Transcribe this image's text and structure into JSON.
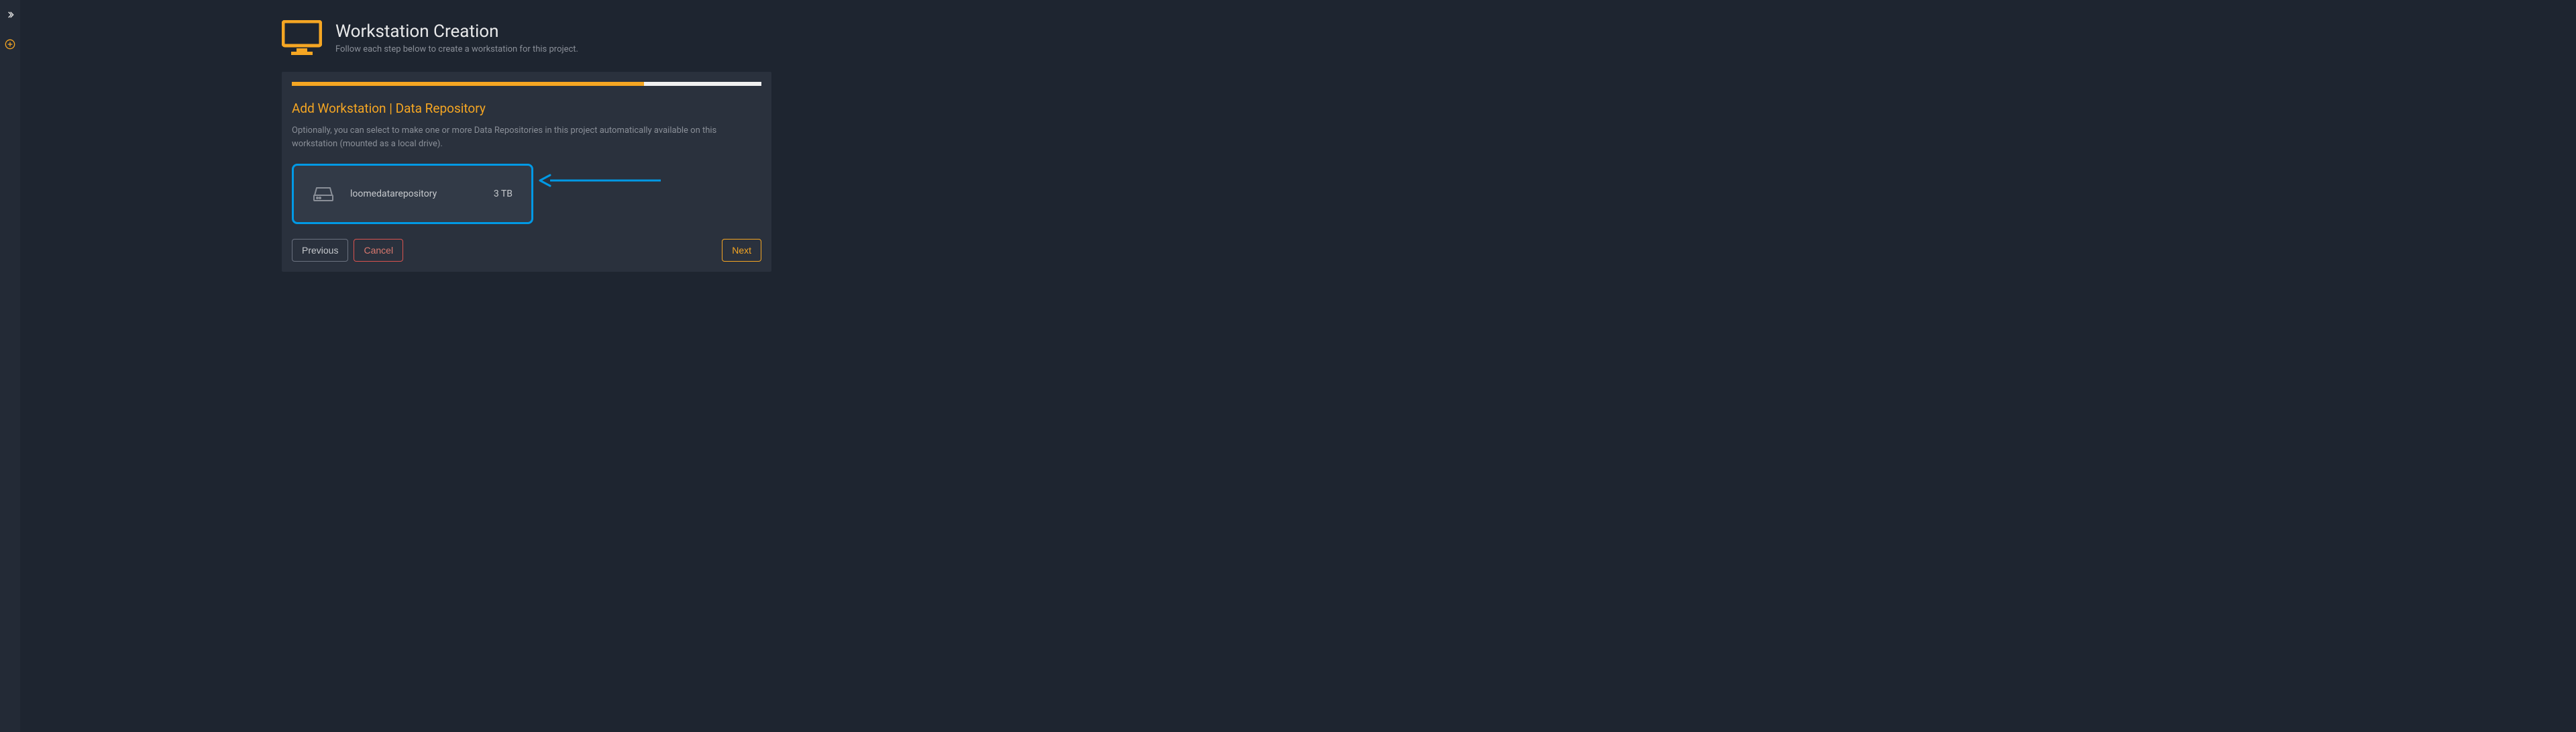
{
  "header": {
    "title": "Workstation Creation",
    "subtitle": "Follow each step below to create a workstation for this project."
  },
  "progress": {
    "percent": 75
  },
  "section": {
    "title": "Add Workstation | Data Repository",
    "description": "Optionally, you can select to make one or more Data Repositories in this project automatically available on this workstation (mounted as a local drive)."
  },
  "repository": {
    "name": "loomedatarepository",
    "size": "3 TB"
  },
  "buttons": {
    "previous": "Previous",
    "cancel": "Cancel",
    "next": "Next"
  }
}
